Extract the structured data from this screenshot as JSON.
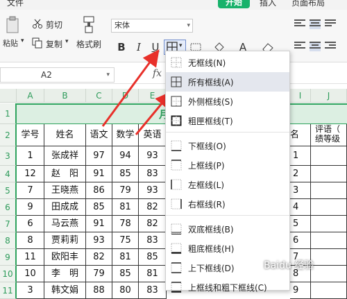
{
  "menubar": {
    "items": [
      "文件",
      "开始",
      "插入",
      "页面布局"
    ],
    "active": "开始"
  },
  "ribbon": {
    "paste_label": "粘贴",
    "cut_label": "剪切",
    "copy_label": "复制",
    "format_painter_label": "格式刷",
    "font_name": "宋体",
    "bold": "B",
    "italic": "I",
    "underline": "U",
    "font_color_glyph": "A"
  },
  "formula_bar": {
    "cell_ref": "A2",
    "fx": "fx"
  },
  "grid": {
    "columns": [
      "A",
      "B",
      "C",
      "D",
      "E",
      "I",
      "J"
    ],
    "rows": [
      "1",
      "2",
      "3",
      "4",
      "5",
      "6",
      "7",
      "8",
      "9",
      "10",
      "11"
    ],
    "row1_fragment": "月",
    "headers": [
      "学号",
      "姓名",
      "语文",
      "数学",
      "英语"
    ],
    "right_header_fragment": "名",
    "right_header_j1": "评语（",
    "right_header_j2": "绩等级",
    "students": [
      {
        "id": "1",
        "name": "张成祥",
        "chinese": "97",
        "math": "94",
        "english": "93",
        "rank": "1"
      },
      {
        "id": "12",
        "name": "赵　阳",
        "chinese": "91",
        "math": "85",
        "english": "83",
        "rank": "2"
      },
      {
        "id": "7",
        "name": "王晓燕",
        "chinese": "86",
        "math": "79",
        "english": "93",
        "rank": "3"
      },
      {
        "id": "9",
        "name": "田成成",
        "chinese": "85",
        "math": "81",
        "english": "82",
        "rank": "4"
      },
      {
        "id": "6",
        "name": "马云燕",
        "chinese": "91",
        "math": "78",
        "english": "82",
        "rank": "5"
      },
      {
        "id": "8",
        "name": "贾莉莉",
        "chinese": "93",
        "math": "75",
        "english": "83",
        "rank": "6"
      },
      {
        "id": "11",
        "name": "欧阳丰",
        "chinese": "82",
        "math": "81",
        "english": "85",
        "rank": "7"
      },
      {
        "id": "10",
        "name": "李　明",
        "chinese": "79",
        "math": "85",
        "english": "81",
        "rank": "8"
      },
      {
        "id": "3",
        "name": "韩文娟",
        "chinese": "88",
        "math": "80",
        "english": "83",
        "rank": "9"
      }
    ]
  },
  "border_menu": {
    "items": [
      {
        "label": "无框线(N)",
        "icon": "no-border-icon"
      },
      {
        "label": "所有框线(A)",
        "icon": "all-borders-icon",
        "highlighted": true
      },
      {
        "label": "外侧框线(S)",
        "icon": "outside-borders-icon"
      },
      {
        "label": "粗匣框线(T)",
        "icon": "thick-box-border-icon"
      },
      {
        "label": "下框线(O)",
        "icon": "bottom-border-icon"
      },
      {
        "label": "上框线(P)",
        "icon": "top-border-icon"
      },
      {
        "label": "左框线(L)",
        "icon": "left-border-icon"
      },
      {
        "label": "右框线(R)",
        "icon": "right-border-icon"
      },
      {
        "label": "双底框线(B)",
        "icon": "double-bottom-border-icon"
      },
      {
        "label": "粗底框线(H)",
        "icon": "thick-bottom-border-icon"
      },
      {
        "label": "上下框线(D)",
        "icon": "top-bottom-border-icon"
      },
      {
        "label": "上框线和粗下框线(C)",
        "icon": "top-thick-bottom-border-icon"
      }
    ]
  },
  "watermark": "Baidu 经验",
  "colors": {
    "accent_green": "#17b26b",
    "arrow_red": "#e8302a",
    "menu_highlight": "#e4e7ee"
  }
}
